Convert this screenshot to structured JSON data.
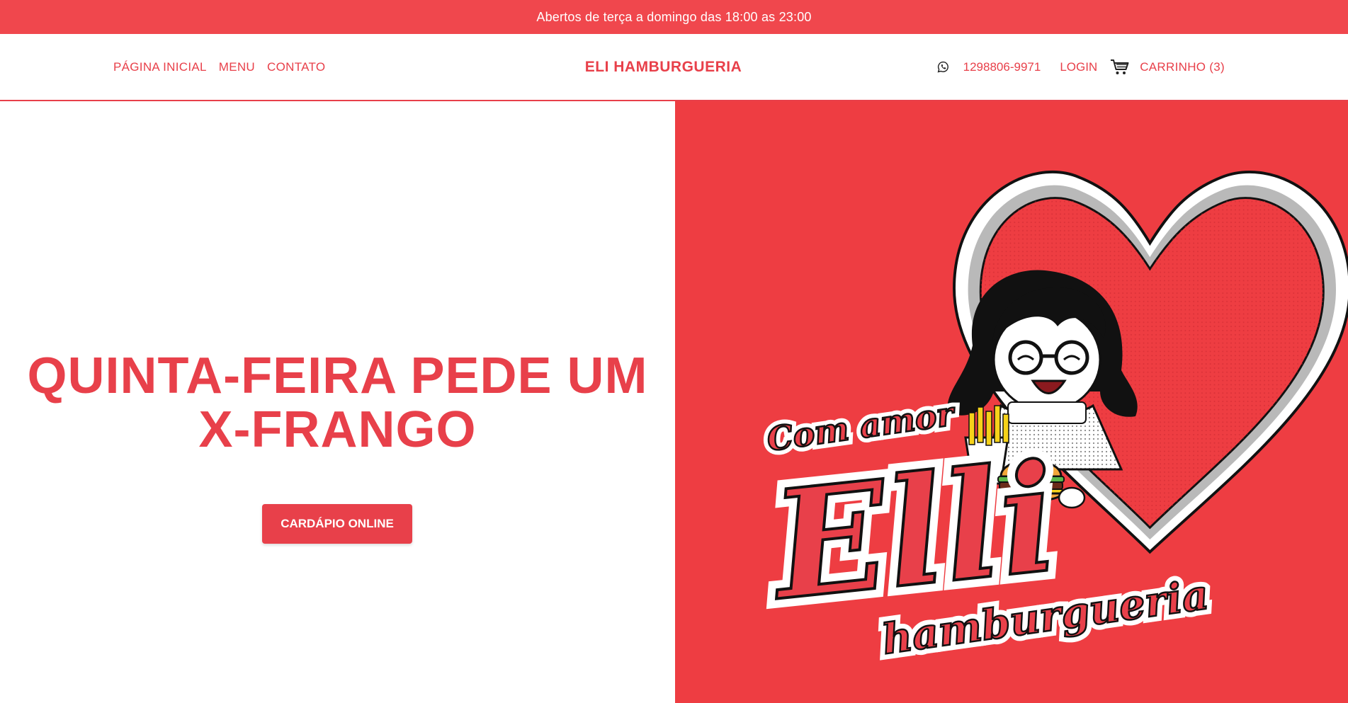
{
  "announcement": {
    "text": "Abertos de terça a domingo das 18:00 as 23:00"
  },
  "header": {
    "nav": [
      {
        "label": "PÁGINA INICIAL"
      },
      {
        "label": "MENU"
      },
      {
        "label": "CONTATO"
      }
    ],
    "brand": "ELI HAMBURGUERIA",
    "phone": "1298806-9971",
    "login": "LOGIN",
    "cart": "CARRINHO (3)",
    "icons": [
      "whatsapp-icon",
      "cart-icon"
    ]
  },
  "hero": {
    "headline_line1": "QUINTA-FEIRA PEDE UM",
    "headline_line2": "X-FRANGO",
    "cta": "CARDÁPIO ONLINE"
  },
  "logo": {
    "script_top": "Com amor",
    "script_main": "Elli",
    "script_bottom": "hamburgueria"
  },
  "colors": {
    "accent": "#e8404a",
    "announce_bg": "#f0474d",
    "hero_right_bg": "#ee3d42",
    "white": "#ffffff"
  }
}
